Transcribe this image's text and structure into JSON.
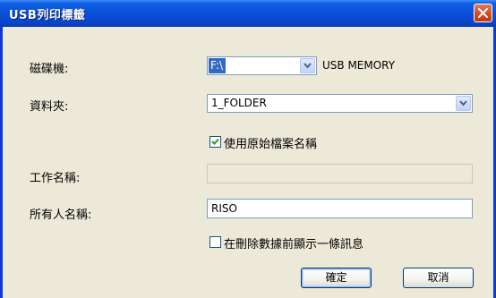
{
  "window": {
    "title": "USB列印標籤"
  },
  "form": {
    "drive": {
      "label": "磁碟機:",
      "value": "F:\\",
      "drive_name": "USB MEMORY"
    },
    "folder": {
      "label": "資料夾:",
      "value": "1_FOLDER"
    },
    "use_original_filename": {
      "label": "使用原始檔案名稱",
      "checked": true
    },
    "job_name": {
      "label": "工作名稱:",
      "value": "",
      "enabled": false
    },
    "owner_name": {
      "label": "所有人名稱:",
      "value": "RISO"
    },
    "confirm_before_delete": {
      "label": "在刪除數據前顯示一條訊息",
      "checked": false
    }
  },
  "buttons": {
    "ok_label": "確定",
    "cancel_label": "取消"
  },
  "icons": {
    "close": "close-icon",
    "dropdown": "chevron-down-icon",
    "check": "checkmark-icon"
  },
  "colors": {
    "titlebar": "#0a4fd8",
    "selection": "#316ac5",
    "dialog_bg": "#ece9d8",
    "close_button": "#d34b1f"
  }
}
